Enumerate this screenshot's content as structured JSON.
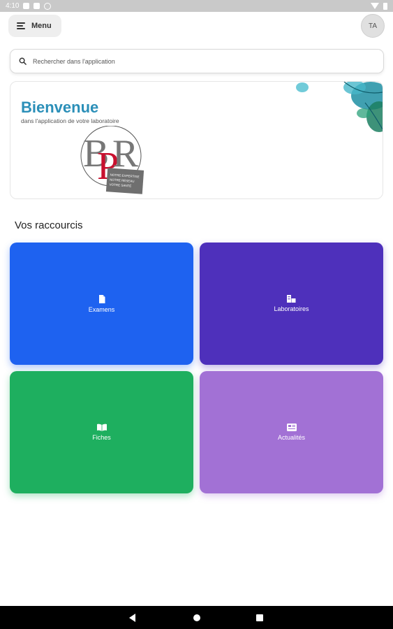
{
  "status_bar": {
    "time": "4:10"
  },
  "header": {
    "menu_label": "Menu",
    "avatar_initials": "TA"
  },
  "search": {
    "placeholder": "Rechercher dans l'application"
  },
  "banner": {
    "title": "Bienvenue",
    "subtitle": "dans l'application de votre laboratoire",
    "logo_text": "BPR",
    "logo_tagline": [
      "NOTRE EXPERTISE",
      "NOTRE RÉSEAU",
      "VOTRE SANTÉ"
    ]
  },
  "shortcuts": {
    "title": "Vos raccourcis",
    "items": [
      {
        "label": "Examens",
        "icon": "document-icon",
        "color": "#1e62f0"
      },
      {
        "label": "Laboratoires",
        "icon": "laboratory-icon",
        "color": "#4e30bb"
      },
      {
        "label": "Fiches",
        "icon": "book-icon",
        "color": "#1eaf5f"
      },
      {
        "label": "Actualités",
        "icon": "news-icon",
        "color": "#a271d5"
      }
    ]
  },
  "nav": {
    "buttons": [
      "back",
      "home",
      "recent"
    ]
  }
}
